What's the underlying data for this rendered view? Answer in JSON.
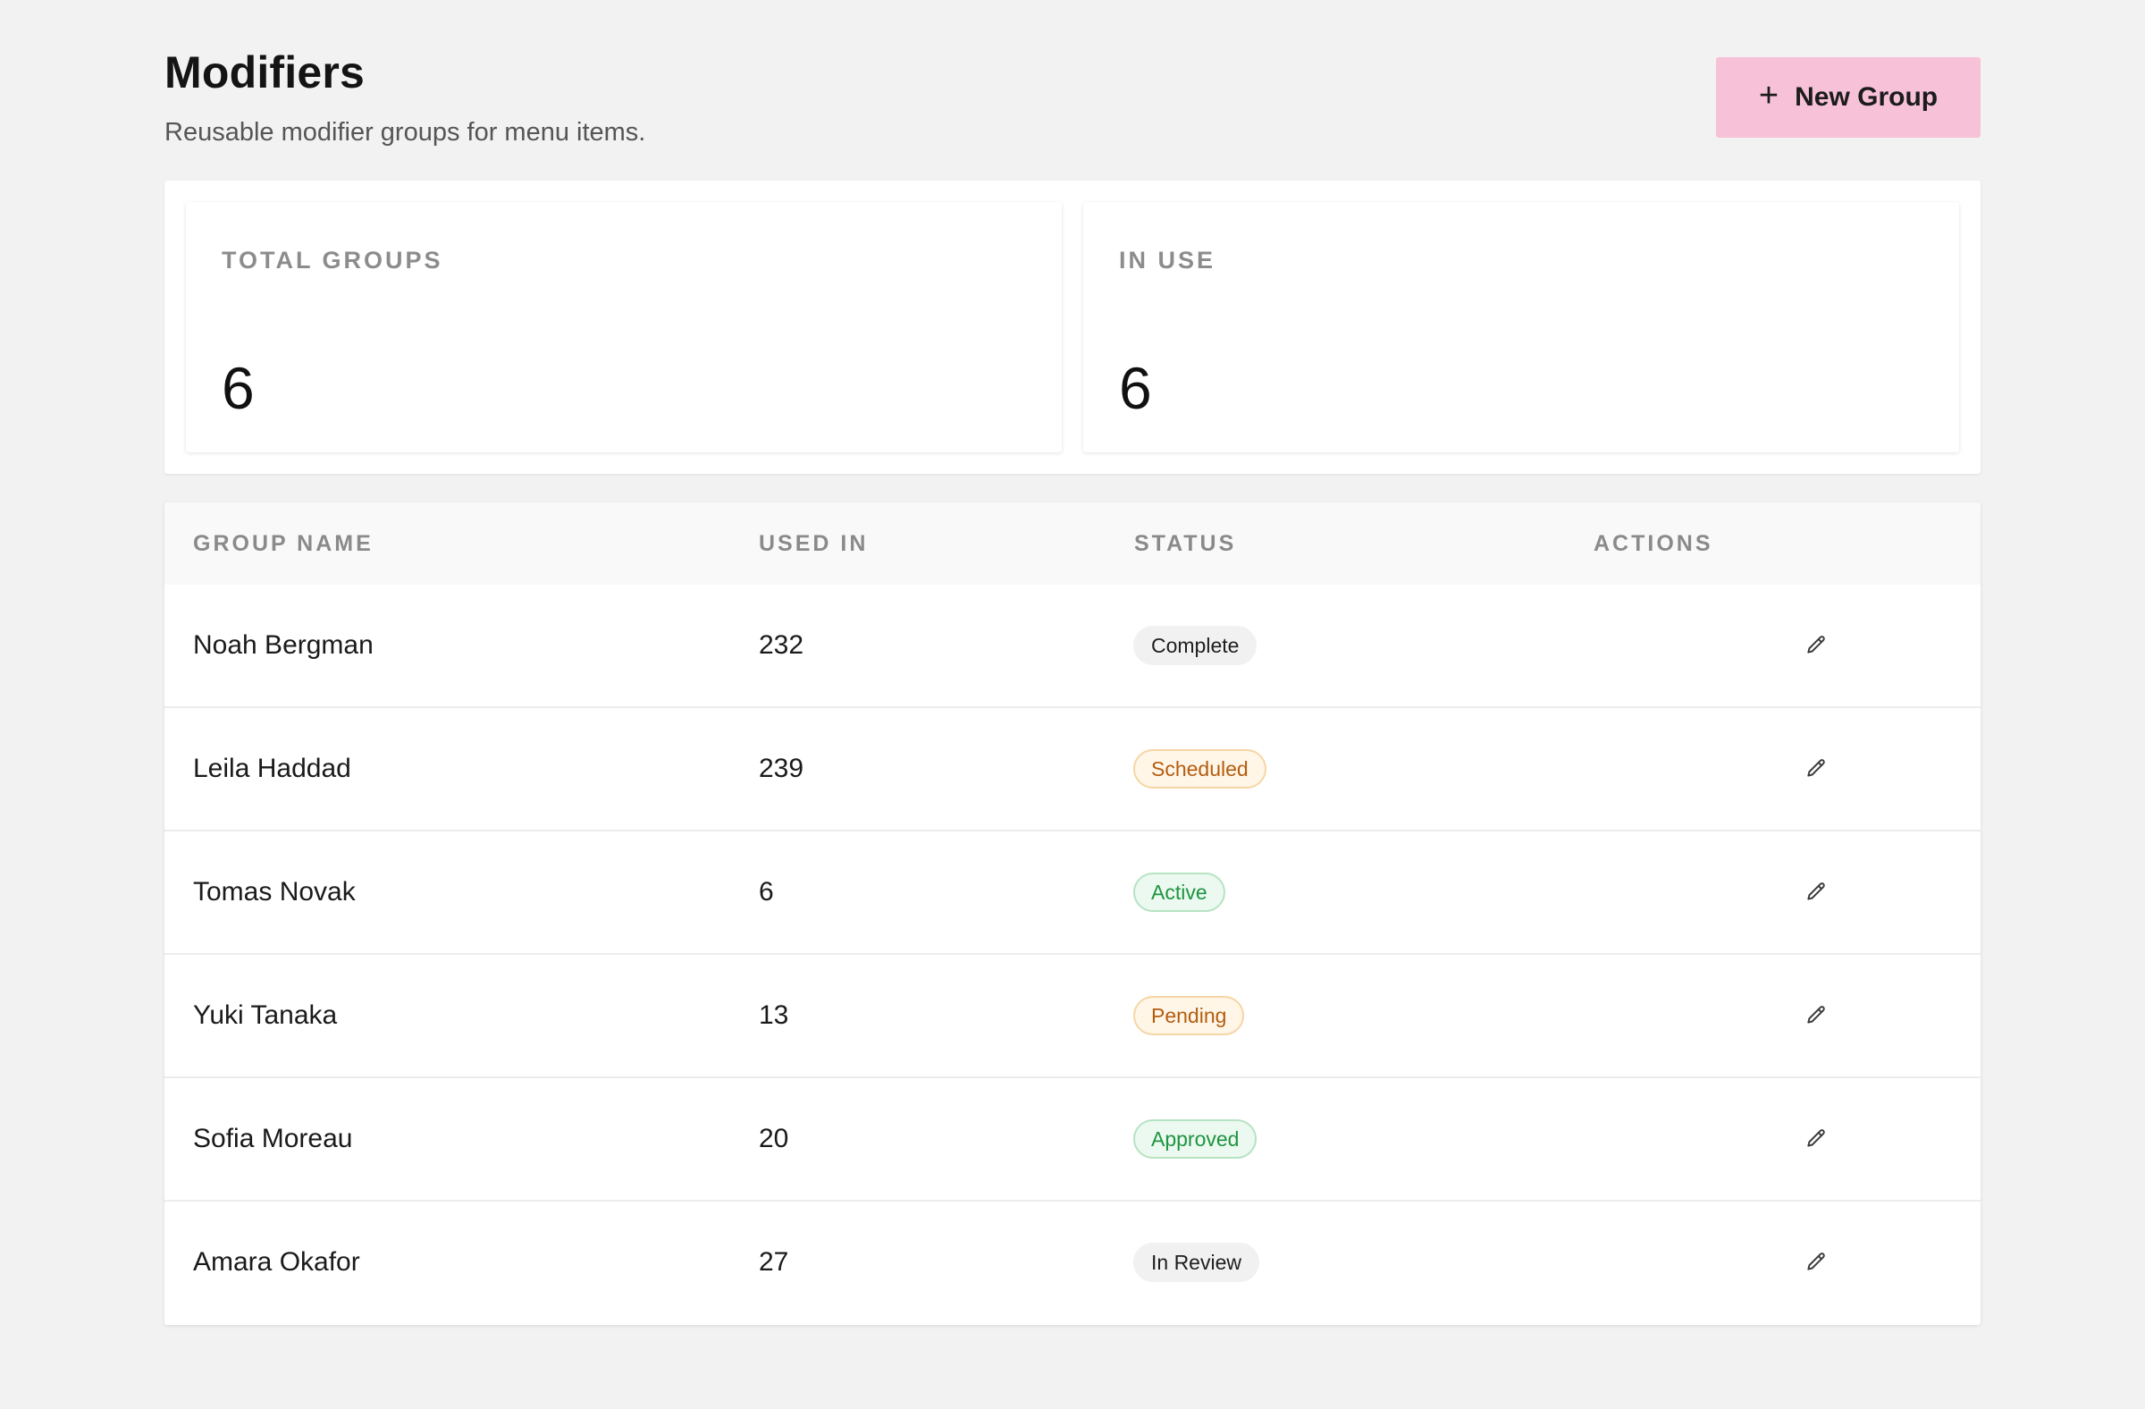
{
  "header": {
    "title": "Modifiers",
    "subtitle": "Reusable modifier groups for menu items.",
    "new_button_label": "New Group",
    "new_button_icon": "plus-icon",
    "new_button_color": "#f7c1d7"
  },
  "stats": [
    {
      "label": "TOTAL GROUPS",
      "value": "6"
    },
    {
      "label": "IN USE",
      "value": "6"
    }
  ],
  "table": {
    "columns": [
      "GROUP NAME",
      "USED IN",
      "STATUS",
      "ACTIONS"
    ],
    "rows": [
      {
        "name": "Noah Bergman",
        "used_in": "232",
        "status": "Complete",
        "status_tone": "neutral",
        "action_icon": "pencil-icon"
      },
      {
        "name": "Leila Haddad",
        "used_in": "239",
        "status": "Scheduled",
        "status_tone": "amber",
        "action_icon": "pencil-icon"
      },
      {
        "name": "Tomas Novak",
        "used_in": "6",
        "status": "Active",
        "status_tone": "green",
        "action_icon": "pencil-icon"
      },
      {
        "name": "Yuki Tanaka",
        "used_in": "13",
        "status": "Pending",
        "status_tone": "amber",
        "action_icon": "pencil-icon"
      },
      {
        "name": "Sofia Moreau",
        "used_in": "20",
        "status": "Approved",
        "status_tone": "green",
        "action_icon": "pencil-icon"
      },
      {
        "name": "Amara Okafor",
        "used_in": "27",
        "status": "In Review",
        "status_tone": "neutral",
        "action_icon": "pencil-icon"
      }
    ]
  },
  "colors": {
    "page_background": "#f2f2f2",
    "accent": "#f7c1d7",
    "badge_neutral": "#f1f1f1",
    "badge_amber_text": "#b45d0f",
    "badge_green_text": "#1e9440"
  }
}
